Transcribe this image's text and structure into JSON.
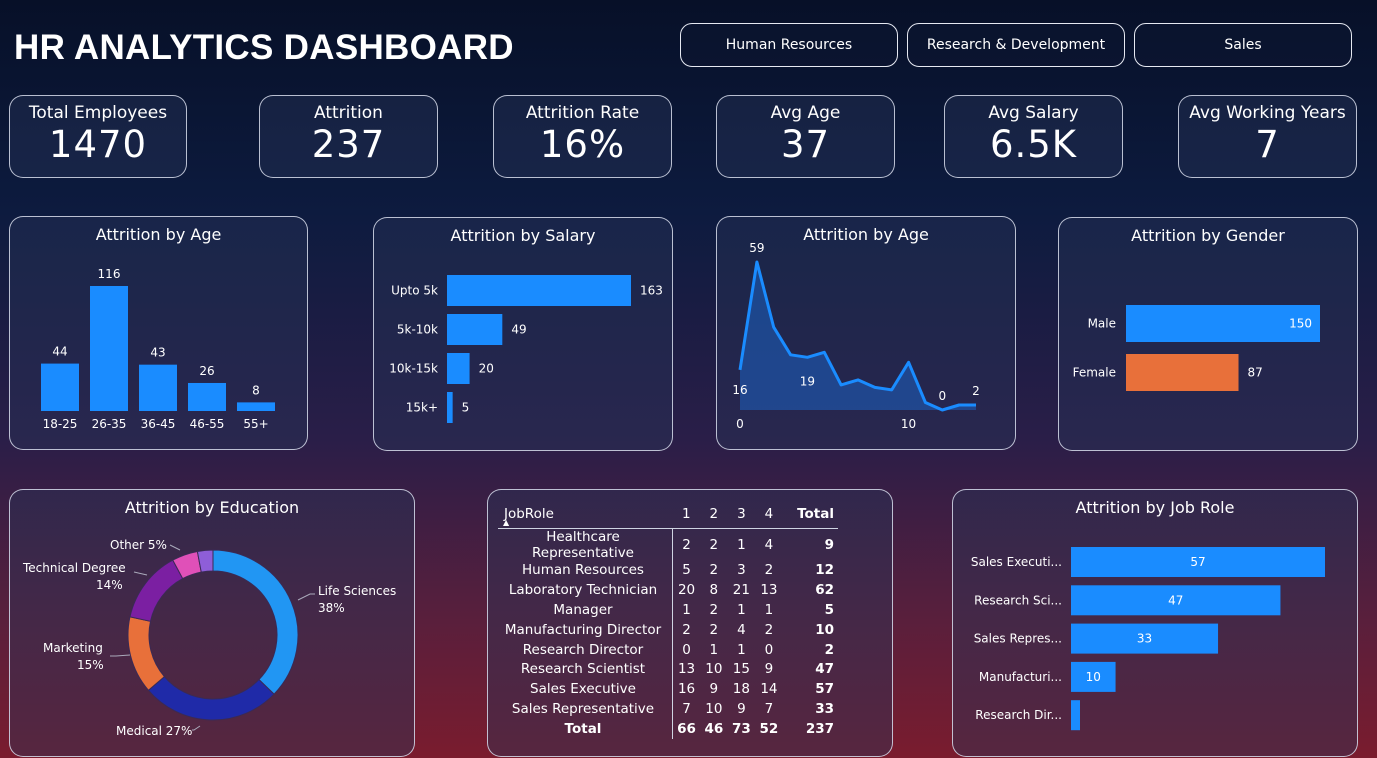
{
  "title": "HR ANALYTICS DASHBOARD",
  "filters": [
    "Human Resources",
    "Research & Development",
    "Sales"
  ],
  "kpis": [
    {
      "label": "Total Employees",
      "value": "1470"
    },
    {
      "label": "Attrition",
      "value": "237"
    },
    {
      "label": "Attrition Rate",
      "value": "16%"
    },
    {
      "label": "Avg Age",
      "value": "37"
    },
    {
      "label": "Avg Salary",
      "value": "6.5K"
    },
    {
      "label": "Avg Working Years",
      "value": "7"
    }
  ],
  "colors": {
    "bar": "#1a8cff",
    "female": "#e8703a",
    "edu_life": "#2196f3",
    "edu_medical": "#1f2aa8",
    "edu_marketing": "#e8703a",
    "edu_technical": "#7b1fa2",
    "edu_other": "#e050b8",
    "edu_extra": "#8e5ed8"
  },
  "chart_data": [
    {
      "id": "age_bar",
      "type": "bar",
      "title": "Attrition by Age",
      "categories": [
        "18-25",
        "26-35",
        "36-45",
        "46-55",
        "55+"
      ],
      "values": [
        44,
        116,
        43,
        26,
        8
      ]
    },
    {
      "id": "salary_bar",
      "type": "bar",
      "orientation": "horizontal",
      "title": "Attrition by Salary",
      "categories": [
        "Upto 5k",
        "5k-10k",
        "10k-15k",
        "15k+"
      ],
      "values": [
        163,
        49,
        20,
        5
      ]
    },
    {
      "id": "age_area",
      "type": "area",
      "title": "Attrition by Age",
      "x_ticks": [
        "0",
        "10"
      ],
      "values": [
        16,
        59,
        33,
        22,
        21,
        23,
        10,
        12,
        9,
        8,
        19,
        3,
        0,
        2,
        2
      ],
      "labels_shown": [
        {
          "i": 0,
          "text": "16"
        },
        {
          "i": 1,
          "text": "59"
        },
        {
          "i": 4,
          "text": "19"
        },
        {
          "i": 12,
          "text": "0"
        },
        {
          "i": 14,
          "text": "2"
        }
      ]
    },
    {
      "id": "gender_bar",
      "type": "bar",
      "orientation": "horizontal",
      "title": "Attrition by Gender",
      "categories": [
        "Male",
        "Female"
      ],
      "values": [
        150,
        87
      ]
    },
    {
      "id": "education_donut",
      "type": "pie",
      "title": "Attrition by Education",
      "slices": [
        {
          "label": "Life Sciences",
          "pct": "38%",
          "value": 38
        },
        {
          "label": "Medical",
          "pct": "27%",
          "value": 27
        },
        {
          "label": "Marketing",
          "pct": "15%",
          "value": 15
        },
        {
          "label": "Technical Degree",
          "pct": "14%",
          "value": 14
        },
        {
          "label": "Other",
          "pct": "5%",
          "value": 5
        },
        {
          "label": "",
          "pct": "",
          "value": 3
        }
      ]
    },
    {
      "id": "jobrole_table",
      "type": "table",
      "columns": [
        "JobRole",
        "1",
        "2",
        "3",
        "4",
        "Total"
      ],
      "rows": [
        [
          "Healthcare Representative",
          "2",
          "2",
          "1",
          "4",
          "9"
        ],
        [
          "Human Resources",
          "5",
          "2",
          "3",
          "2",
          "12"
        ],
        [
          "Laboratory Technician",
          "20",
          "8",
          "21",
          "13",
          "62"
        ],
        [
          "Manager",
          "1",
          "2",
          "1",
          "1",
          "5"
        ],
        [
          "Manufacturing Director",
          "2",
          "2",
          "4",
          "2",
          "10"
        ],
        [
          "Research Director",
          "0",
          "1",
          "1",
          "0",
          "2"
        ],
        [
          "Research Scientist",
          "13",
          "10",
          "15",
          "9",
          "47"
        ],
        [
          "Sales Executive",
          "16",
          "9",
          "18",
          "14",
          "57"
        ],
        [
          "Sales Representative",
          "7",
          "10",
          "9",
          "7",
          "33"
        ],
        [
          "Total",
          "66",
          "46",
          "73",
          "52",
          "237"
        ]
      ]
    },
    {
      "id": "jobrole_bar",
      "type": "bar",
      "orientation": "horizontal",
      "title": "Attrition by Job Role",
      "categories": [
        "Sales Executi...",
        "Research Sci...",
        "Sales Repres...",
        "Manufacturi...",
        "Research Dir..."
      ],
      "values": [
        57,
        47,
        33,
        10,
        2
      ],
      "value_labels": [
        "57",
        "47",
        "33",
        "10",
        ""
      ]
    }
  ]
}
